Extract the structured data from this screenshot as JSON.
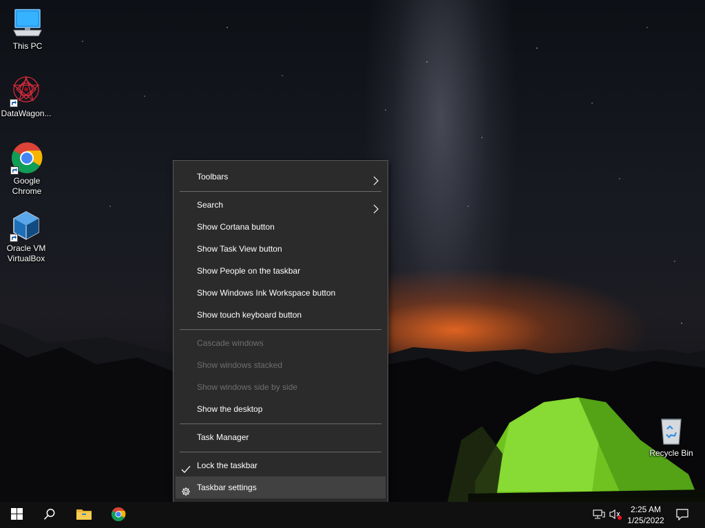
{
  "desktop": {
    "icons": [
      {
        "label": "This PC",
        "icon": "computer-icon"
      },
      {
        "label": "DataWagon...",
        "icon": "datawagon-icon"
      },
      {
        "label": "Google Chrome",
        "icon": "chrome-icon"
      },
      {
        "label": "Oracle VM VirtualBox",
        "icon": "virtualbox-icon"
      },
      {
        "label": "Recycle Bin",
        "icon": "recycle-bin-icon"
      }
    ]
  },
  "context_menu": {
    "items": [
      {
        "label": "Toolbars",
        "submenu": true
      },
      {
        "label": "Search",
        "submenu": true
      },
      {
        "label": "Show Cortana button"
      },
      {
        "label": "Show Task View button"
      },
      {
        "label": "Show People on the taskbar"
      },
      {
        "label": "Show Windows Ink Workspace button"
      },
      {
        "label": "Show touch keyboard button"
      },
      {
        "label": "Cascade windows",
        "disabled": true
      },
      {
        "label": "Show windows stacked",
        "disabled": true
      },
      {
        "label": "Show windows side by side",
        "disabled": true
      },
      {
        "label": "Show the desktop"
      },
      {
        "label": "Task Manager"
      },
      {
        "label": "Lock the taskbar",
        "checked": true
      },
      {
        "label": "Taskbar settings",
        "icon": "gear-icon",
        "highlighted": true
      }
    ]
  },
  "taskbar": {
    "buttons": [
      "start-icon",
      "search-icon",
      "file-explorer-icon",
      "chrome-icon"
    ],
    "tray": [
      "network-icon",
      "volume-muted-icon",
      "action-center-icon"
    ],
    "clock": {
      "time": "2:25 AM",
      "date": "1/25/2022"
    }
  },
  "colors": {
    "menu_bg": "#2b2b2b",
    "menu_hover": "#414141",
    "taskbar_bg": "#101010",
    "disabled_text": "#6f6f6f"
  }
}
